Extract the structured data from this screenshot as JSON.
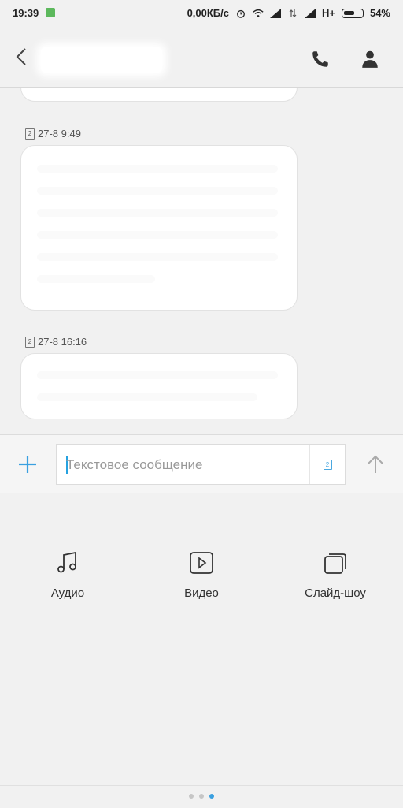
{
  "status_bar": {
    "time": "19:39",
    "network_speed": "0,00КБ/с",
    "network_type": "H+",
    "battery": "54%"
  },
  "header": {
    "contact_name": "",
    "back_icon": "chevron-left-icon",
    "call_icon": "phone-icon",
    "profile_icon": "person-icon"
  },
  "messages": [
    {
      "sim": "2",
      "timestamp": "27-8 9:49",
      "text": ""
    },
    {
      "sim": "2",
      "timestamp": "27-8 16:16",
      "text": ""
    }
  ],
  "composer": {
    "placeholder": "Текстовое сообщение",
    "value": "",
    "sim_label": "2"
  },
  "attachments": [
    {
      "label": "Аудио",
      "icon": "music-note-icon"
    },
    {
      "label": "Видео",
      "icon": "video-play-icon"
    },
    {
      "label": "Слайд-шоу",
      "icon": "slideshow-icon"
    }
  ],
  "pager": {
    "pages": 3,
    "active_index": 2
  },
  "colors": {
    "accent": "#3aa0e0",
    "background": "#f1f1f1",
    "bubble": "#ffffff"
  }
}
